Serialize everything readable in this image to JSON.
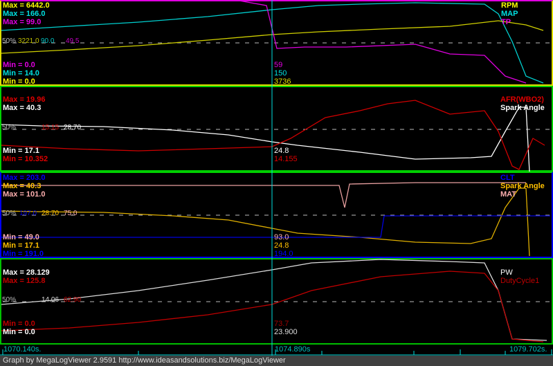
{
  "panels": [
    {
      "max": [
        "Max = 6442.0",
        "Max = 166.0",
        "Max = 99.0"
      ],
      "mid": [
        "50%",
        "3221.0",
        "90.0",
        "49.5"
      ],
      "min": [
        "Min = 0.0",
        "Min = 14.0",
        "Min = 0.0"
      ],
      "cursor": [
        "59",
        "150",
        "3736"
      ],
      "legend": [
        "RPM",
        "MAP",
        "TP"
      ]
    },
    {
      "max": [
        "Max = 19.96",
        "Max = 40.3"
      ],
      "mid": [
        "50%",
        "15.15",
        "28.70"
      ],
      "min": [
        "Min = 17.1",
        "Min = 10.352"
      ],
      "cursor": [
        "24.8",
        "14.155"
      ],
      "legend": [
        "AFR(WBO2)",
        "Spark Angle"
      ]
    },
    {
      "max": [
        "Max = 203.0",
        "Max = 40.3",
        "Max = 101.0"
      ],
      "mid": [
        "50%",
        "197.0",
        "28.70",
        "75.0"
      ],
      "min": [
        "Min = 49.0",
        "Min = 17.1",
        "Min = 191.0"
      ],
      "cursor": [
        "93.0",
        "24.8",
        "194.0"
      ],
      "legend": [
        "CLT",
        "Spark Angle",
        "MAT"
      ]
    },
    {
      "max": [
        "Max = 28.129",
        "Max = 125.8"
      ],
      "mid": [
        "50%",
        "14.06",
        "62.90"
      ],
      "min": [
        "Min = 0.0",
        "Min = 0.0"
      ],
      "cursor": [
        "73.7",
        "23.900"
      ],
      "legend": [
        "PW",
        "DutyCycle1"
      ]
    }
  ],
  "time": {
    "start": "1070.140s.",
    "cursor": "1074.890s",
    "end": "1079.702s."
  },
  "footer": "Graph by MegaLogViewer 2.9591 http://www.ideasandsolutions.biz/MegaLogViewer",
  "colors": {
    "rpm": "#ffff00",
    "map": "#00e0e0",
    "tp": "#e000e0",
    "afr": "#e00000",
    "spark": "#ffffff",
    "clt": "#0000ff",
    "spark2": "#ffc000",
    "mat": "#ffb0b0",
    "pw": "#ffffff",
    "duty": "#c00000"
  }
}
